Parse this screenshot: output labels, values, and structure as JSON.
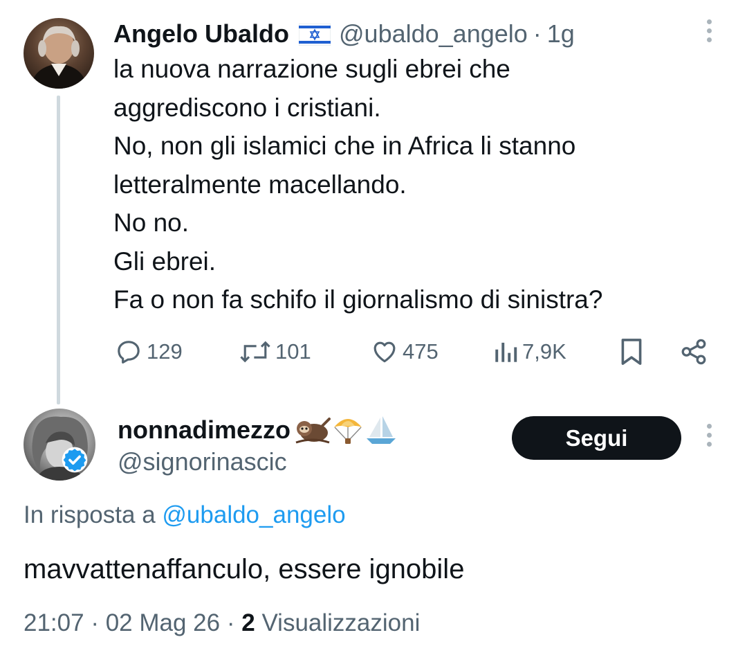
{
  "original_tweet": {
    "author": {
      "name": "Angelo Ubaldo",
      "flag_icon": "israel-flag-icon",
      "handle": "@ubaldo_angelo",
      "separator": "·",
      "time": "1g"
    },
    "text_lines": [
      "la nuova narrazione sugli ebrei che",
      "aggrediscono i cristiani.",
      "No, non gli islamici che in Africa li stanno",
      "letteralmente macellando.",
      "No no.",
      "Gli ebrei.",
      "Fa o non fa schifo il giornalismo di sinistra?"
    ],
    "actions": {
      "replies": "129",
      "retweets": "101",
      "likes": "475",
      "views": "7,9K"
    }
  },
  "reply_tweet": {
    "author": {
      "name": "nonnadimezzo",
      "emojis": [
        "sloth",
        "parachute",
        "sailboat"
      ],
      "handle": "@signorinascic",
      "verified": true
    },
    "follow_label": "Segui",
    "reply_prefix": "In risposta a",
    "reply_mention": "@ubaldo_angelo",
    "text": "mavvattenaffanculo, essere ignobile",
    "meta": {
      "time": "21:07",
      "separator": "·",
      "date": "02 Mag 26",
      "views_count": "2",
      "views_label": "Visualizzazioni"
    }
  },
  "colors": {
    "text_primary": "#0f1419",
    "text_secondary": "#536471",
    "link_blue": "#1d9bf0",
    "thread_line": "#cfd9de",
    "button_dark": "#0f1419",
    "verified_blue": "#1d9bf0"
  }
}
